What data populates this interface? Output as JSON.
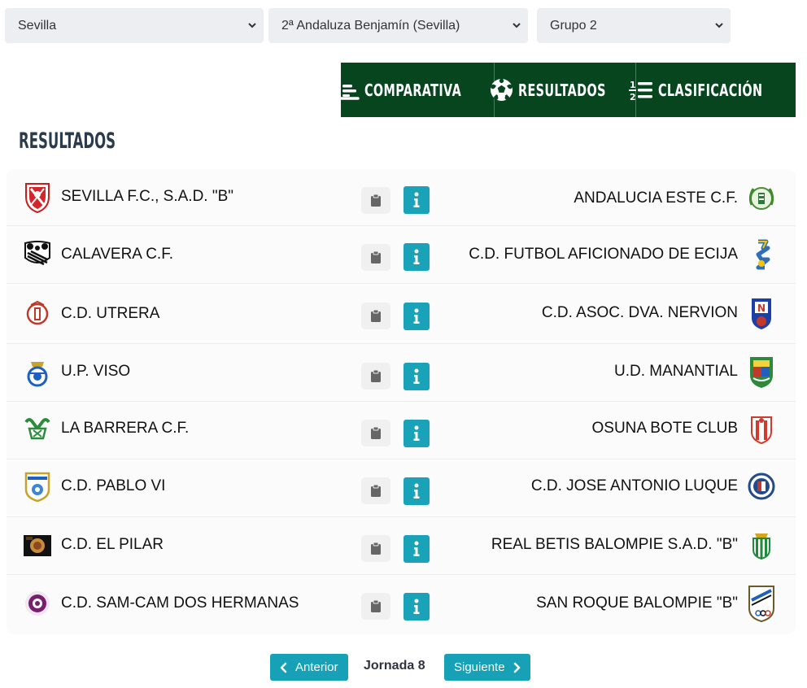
{
  "filters": {
    "province": "Sevilla",
    "competition": "2ª Andaluza Benjamín (Sevilla)",
    "group": "Grupo 2"
  },
  "tabs": [
    {
      "label": "COMPARATIVA",
      "icon": "chart-bars-icon"
    },
    {
      "label": "RESULTADOS",
      "icon": "soccer-ball-icon"
    },
    {
      "label": "CLASIFICACIÓN",
      "icon": "ranking-list-icon"
    }
  ],
  "section_title": "RESULTADOS",
  "matches": [
    {
      "home": "SEVILLA F.C., S.A.D. \"B\"",
      "away": "ANDALUCIA ESTE C.F."
    },
    {
      "home": "CALAVERA C.F.",
      "away": "C.D. FUTBOL AFICIONADO DE ECIJA"
    },
    {
      "home": "C.D. UTRERA",
      "away": "C.D. ASOC. DVA. NERVION"
    },
    {
      "home": "U.P. VISO",
      "away": "U.D. MANANTIAL"
    },
    {
      "home": "LA BARRERA C.F.",
      "away": "OSUNA BOTE CLUB"
    },
    {
      "home": "C.D. PABLO VI",
      "away": "C.D. JOSE ANTONIO LUQUE"
    },
    {
      "home": "C.D. EL PILAR",
      "away": "REAL BETIS BALOMPIE S.A.D. \"B\""
    },
    {
      "home": "C.D. SAM-CAM DOS HERMANAS",
      "away": "SAN ROQUE BALOMPIE \"B\""
    }
  ],
  "pager": {
    "prev": "Anterior",
    "jornada": "Jornada 8",
    "next": "Siguiente"
  },
  "colors": {
    "tab_bg": "#07451f",
    "info_button": "#1aa3b8",
    "pager_button": "#16a1b7"
  }
}
